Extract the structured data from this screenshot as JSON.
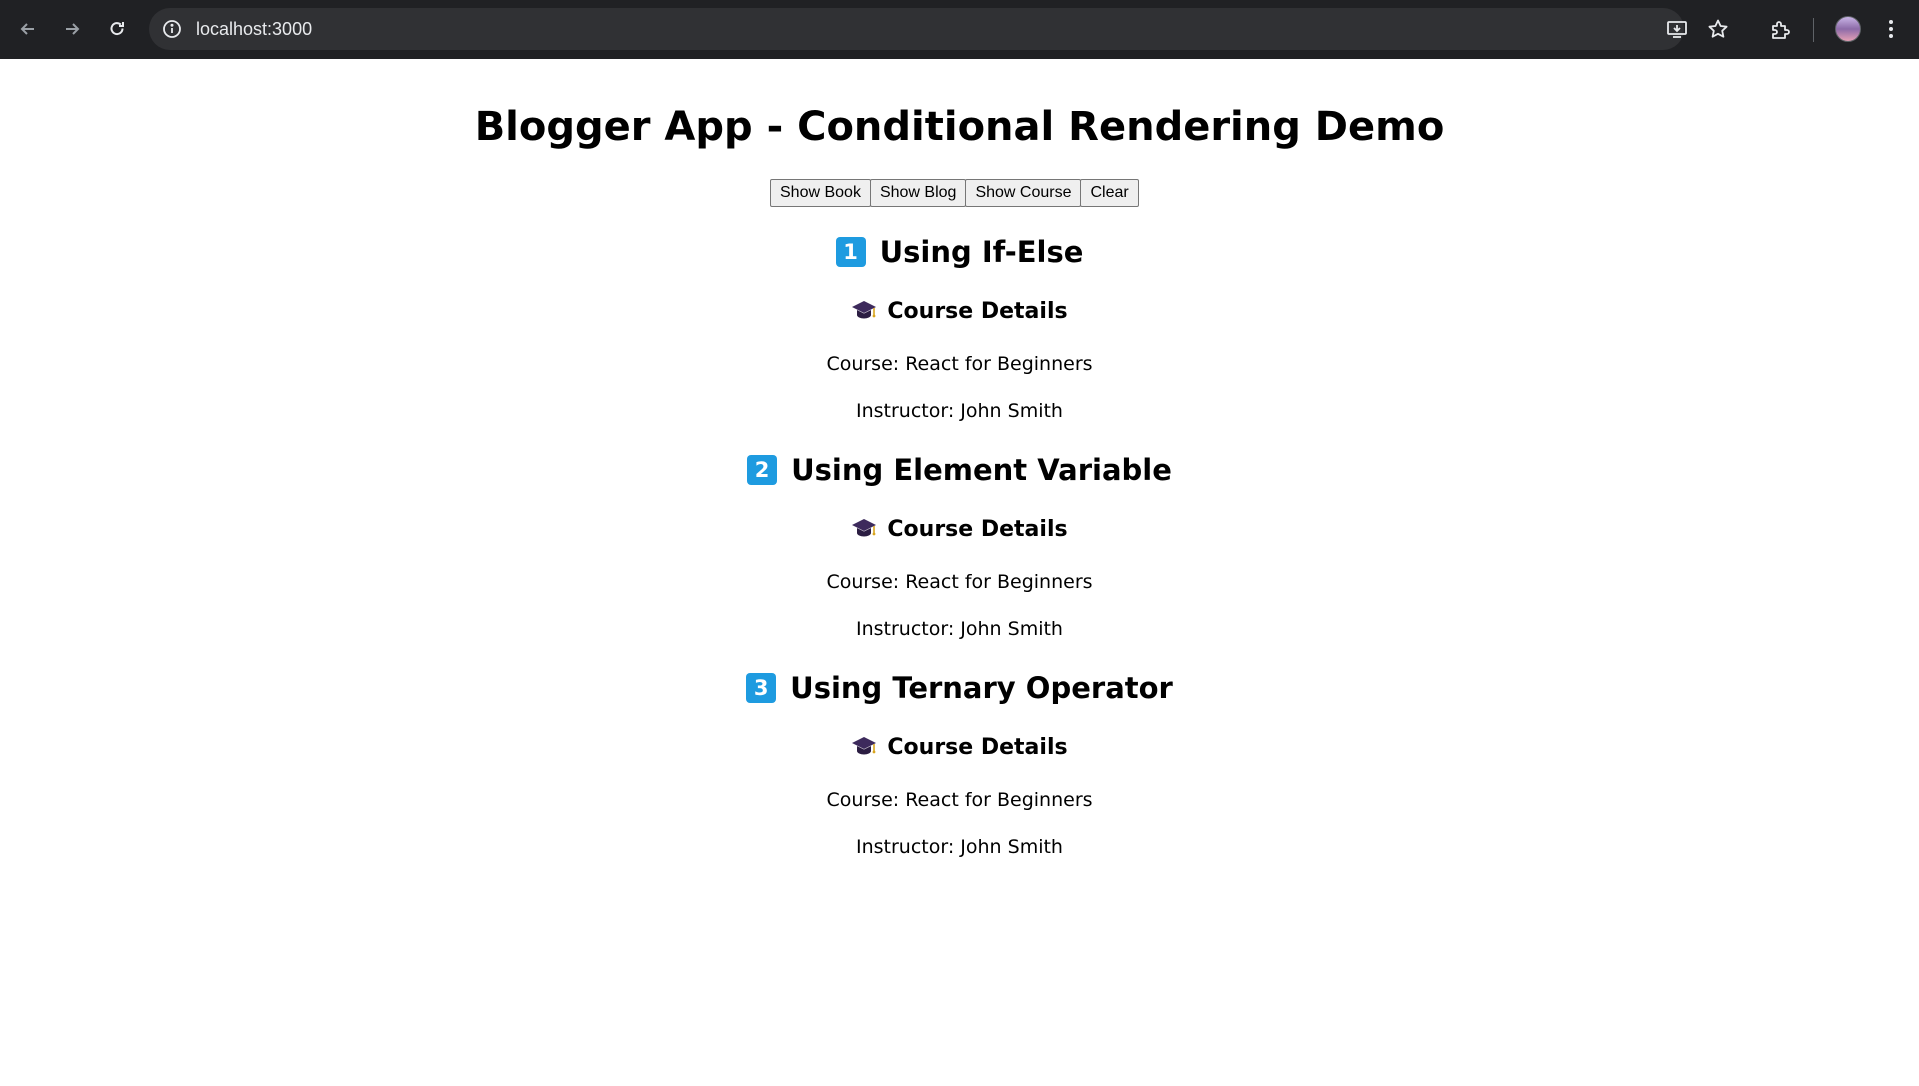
{
  "browser": {
    "url": "localhost:3000"
  },
  "page": {
    "title": "Blogger App - Conditional Rendering Demo",
    "buttons": {
      "show_book": "Show Book",
      "show_blog": "Show Blog",
      "show_course": "Show Course",
      "clear": "Clear"
    },
    "sections": [
      {
        "number": "1",
        "heading": "Using If-Else",
        "subheading": "Course Details",
        "course": "Course: React for Beginners",
        "instructor": "Instructor: John Smith"
      },
      {
        "number": "2",
        "heading": "Using Element Variable",
        "subheading": "Course Details",
        "course": "Course: React for Beginners",
        "instructor": "Instructor: John Smith"
      },
      {
        "number": "3",
        "heading": "Using Ternary Operator",
        "subheading": "Course Details",
        "course": "Course: React for Beginners",
        "instructor": "Instructor: John Smith"
      }
    ]
  },
  "icons": {
    "back": "arrow-left-icon",
    "forward": "arrow-right-icon",
    "reload": "reload-icon",
    "site_info": "info-icon",
    "install": "install-app-icon",
    "bookmark": "star-icon",
    "extensions": "puzzle-icon",
    "profile": "avatar",
    "menu": "kebab-menu-icon",
    "section_marker": "keycap-number-icon",
    "course": "graduation-cap-icon"
  },
  "colors": {
    "chrome_bg": "#202124",
    "omnibox_bg": "#303134",
    "keycap_blue": "#1e9be0"
  }
}
